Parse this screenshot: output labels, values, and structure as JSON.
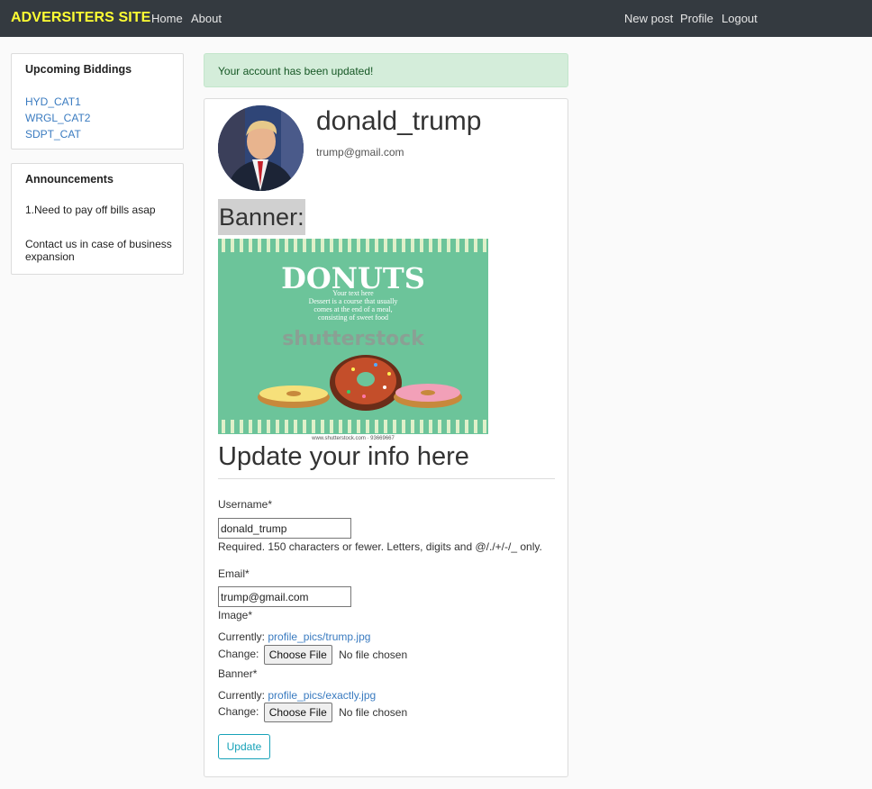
{
  "navbar": {
    "brand": "ADVERSITERS SITE",
    "home": "Home",
    "about": "About",
    "new_post": "New post",
    "profile": "Profile",
    "logout": "Logout"
  },
  "sidebar": {
    "biddings": {
      "title": "Upcoming Biddings",
      "items": [
        "HYD_CAT1",
        "WRGL_CAT2",
        "SDPT_CAT"
      ]
    },
    "announcements": {
      "title": "Announcements",
      "items": [
        "1.Need to pay off bills asap",
        "Contact us in case of business expansion"
      ]
    }
  },
  "alert": {
    "message": "Your account has been updated!"
  },
  "profile": {
    "username": "donald_trump",
    "email": "trump@gmail.com",
    "banner_label": "Banner:",
    "banner_image": {
      "heading": "DONUTS",
      "body_lines": [
        "Your text here",
        "Dessert is a course that usually",
        "comes at the end of a meal,",
        "consisting of sweet food"
      ],
      "watermark": "shutterstock",
      "footer": "www.shutterstock.com · 93669667"
    }
  },
  "form": {
    "title": "Update your info here",
    "username_label": "Username*",
    "username_value": "donald_trump",
    "username_help": "Required. 150 characters or fewer. Letters, digits and @/./+/-/_ only.",
    "email_label": "Email*",
    "email_value": "trump@gmail.com",
    "image_label": "Image*",
    "image_currently_label": "Currently:",
    "image_current_file": "profile_pics/trump.jpg",
    "image_change_label": "Change:",
    "banner_label": "Banner*",
    "banner_currently_label": "Currently:",
    "banner_current_file": "profile_pics/exactly.jpg",
    "banner_change_label": "Change:",
    "choose_file_label": "Choose File",
    "no_file_label": "No file chosen",
    "submit_label": "Update"
  },
  "colors": {
    "navbar_bg": "#343a40",
    "brand": "#ffff33",
    "link": "#3a7bc0",
    "alert_bg": "#d4edda",
    "alert_text": "#155724",
    "button_accent": "#17a2b8",
    "banner_bg": "#6cc49a"
  }
}
